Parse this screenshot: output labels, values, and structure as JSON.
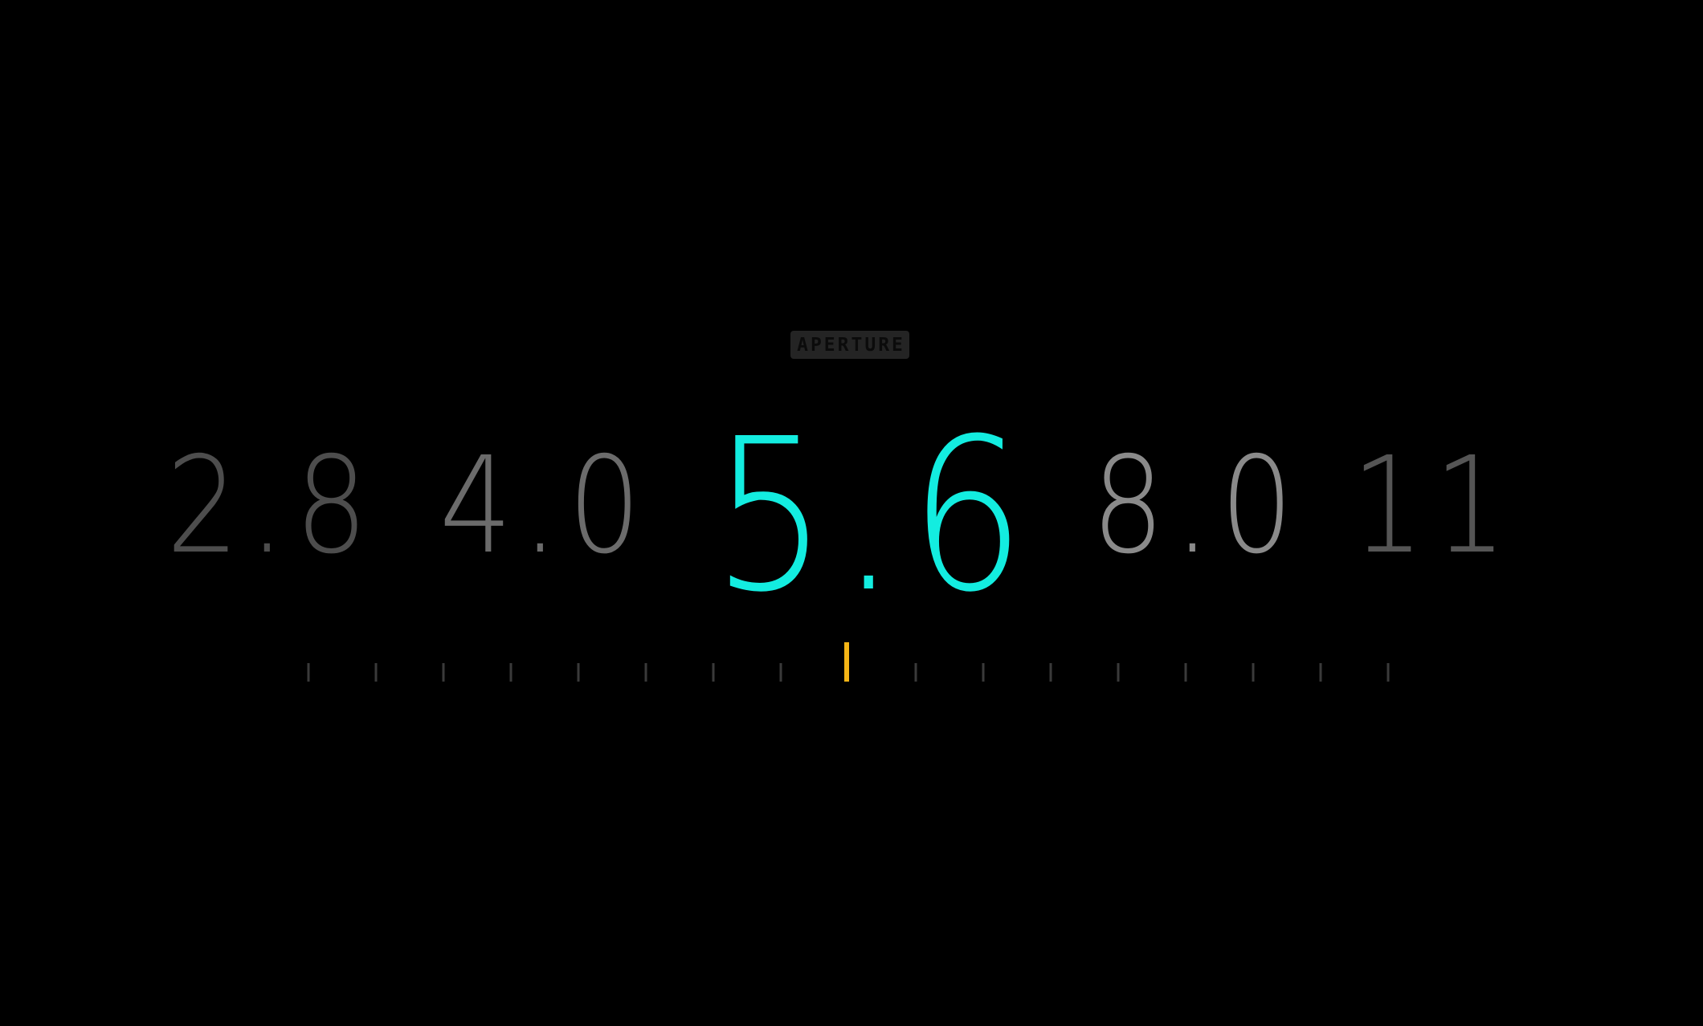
{
  "dial": {
    "label": "APERTURE",
    "stops": [
      "2.8",
      "4.0",
      "5.6",
      "8.0",
      "11"
    ],
    "selected": "5.6"
  },
  "colors": {
    "background": "#000000",
    "selected": "#13ede0",
    "indicator": "#f5b516",
    "tick": "#3a3a3a",
    "badge_bg": "#242424"
  }
}
